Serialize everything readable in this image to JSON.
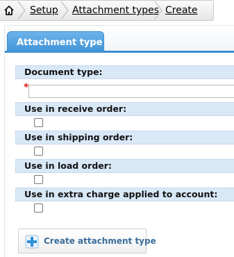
{
  "breadcrumb": {
    "home_icon": "home-icon",
    "items": [
      {
        "label": "Setup"
      },
      {
        "label": "Attachment types"
      },
      {
        "label": "Create"
      }
    ]
  },
  "tab": {
    "label": "Attachment type"
  },
  "form": {
    "document_type": {
      "label": "Document type:",
      "value": "",
      "required": true
    },
    "use_in_receive_order": {
      "label": "Use in receive order:",
      "checked": false
    },
    "use_in_shipping_order": {
      "label": "Use in shipping order:",
      "checked": false
    },
    "use_in_load_order": {
      "label": "Use in load order:",
      "checked": false
    },
    "use_in_extra_charge": {
      "label": "Use in extra charge applied to account:",
      "checked": false
    }
  },
  "actions": {
    "create_label": "Create attachment type",
    "create_icon": "plus-icon"
  },
  "colors": {
    "tab_blue": "#3d8ecf",
    "label_bg": "#d9e8f7",
    "button_text": "#3b6e9a",
    "required": "#e02020"
  }
}
